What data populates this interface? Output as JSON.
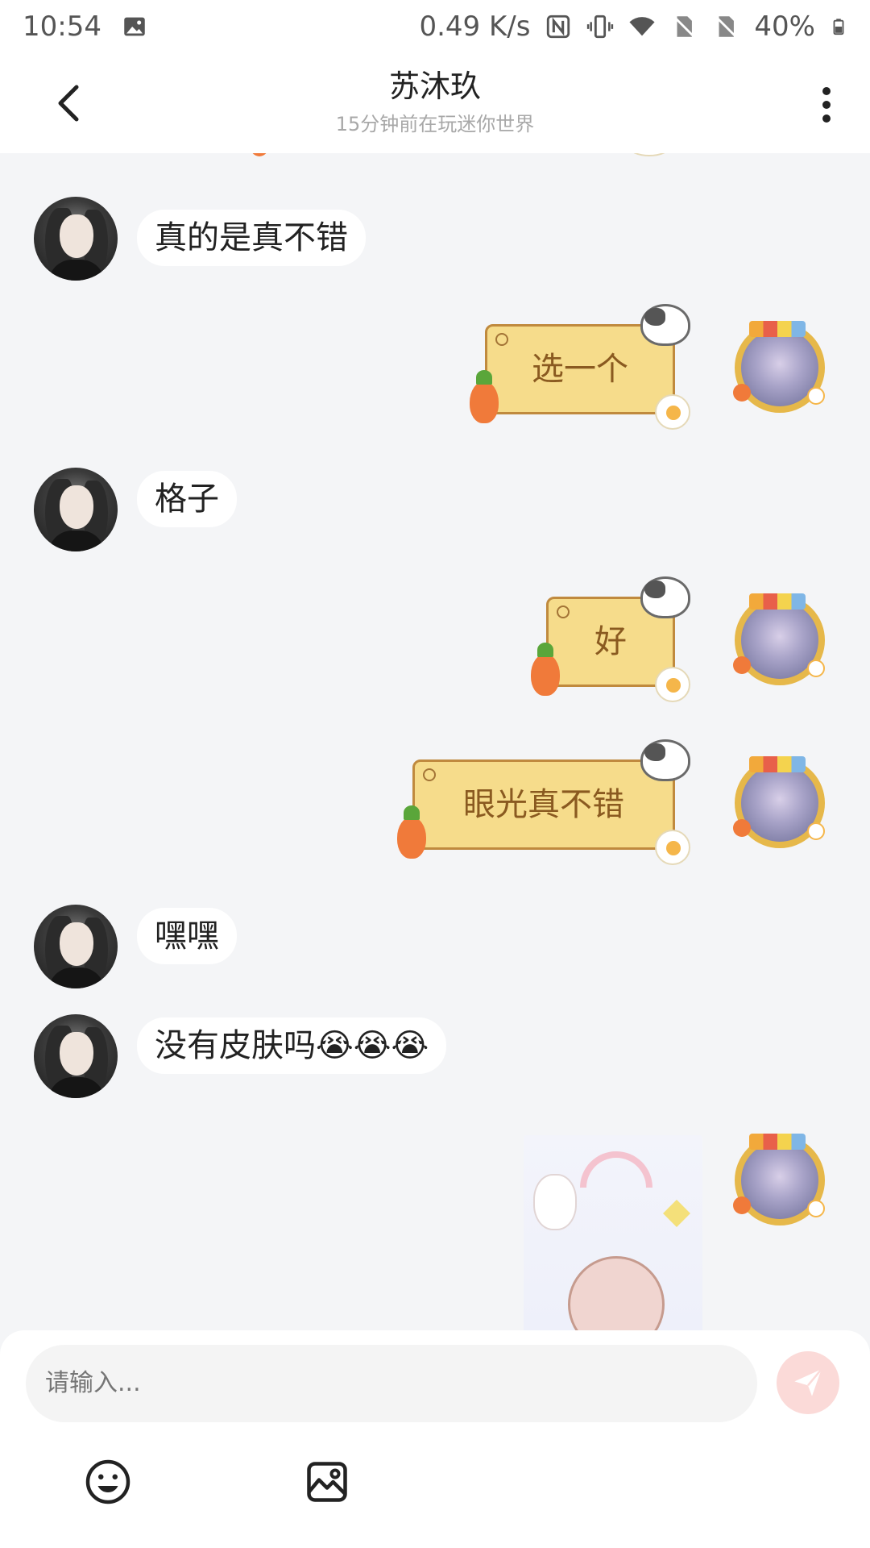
{
  "status_bar": {
    "time": "10:54",
    "speed": "0.49 K/s",
    "battery": "40%",
    "icons": [
      "image-icon",
      "nfc-icon",
      "vibrate-icon",
      "wifi-icon",
      "no-sim-icon",
      "no-sim-icon",
      "battery-icon"
    ]
  },
  "header": {
    "title": "苏沐玖",
    "subtitle": "15分钟前在玩迷你世界",
    "back_icon": "chevron-left-icon",
    "more_icon": "more-vertical-icon"
  },
  "messages": [
    {
      "side": "left",
      "text": "真的是真不错"
    },
    {
      "side": "right",
      "text": "选一个"
    },
    {
      "side": "left",
      "text": "格子"
    },
    {
      "side": "right",
      "text": "好"
    },
    {
      "side": "right",
      "text": "眼光真不错"
    },
    {
      "side": "left",
      "text": "嘿嘿"
    },
    {
      "side": "left",
      "text": "没有皮肤吗😭😭😭"
    },
    {
      "side": "right",
      "type": "sticker",
      "image": "anime-girl-sticker"
    }
  ],
  "composer": {
    "placeholder": "请输入...",
    "send_icon": "paper-plane-icon",
    "tools": [
      "smiley-icon",
      "image-icon"
    ]
  },
  "colors": {
    "bubble_right_fill": "#f6dc8b",
    "bubble_right_text": "#8a5a20",
    "send_button": "#fbdad8",
    "background": "#f4f5f7"
  }
}
